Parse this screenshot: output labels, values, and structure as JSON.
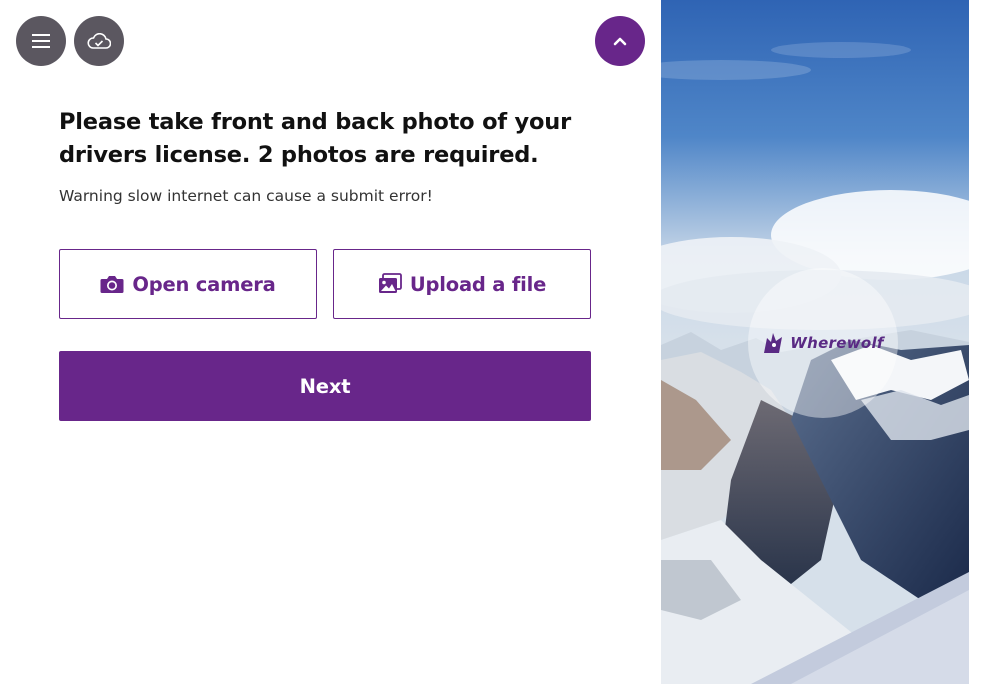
{
  "toolbar": {
    "menu_icon": "hamburger-menu-icon",
    "cloud_icon": "cloud-check-icon",
    "collapse_icon": "chevron-up-icon"
  },
  "content": {
    "heading": "Please take front and back photo of your drivers license. 2  photos are required.",
    "warning": "Warning slow internet can cause a submit error!"
  },
  "actions": {
    "open_camera": {
      "label": "Open camera",
      "icon": "camera-icon"
    },
    "upload_file": {
      "label": "Upload a file",
      "icon": "images-icon"
    },
    "next": {
      "label": "Next"
    }
  },
  "brand": {
    "name": "Wherewolf",
    "icon": "wolf-logo-icon"
  },
  "colors": {
    "accent": "#68268a",
    "toolbar_button": "#5b5760",
    "text": "#111111",
    "background": "#ffffff"
  }
}
